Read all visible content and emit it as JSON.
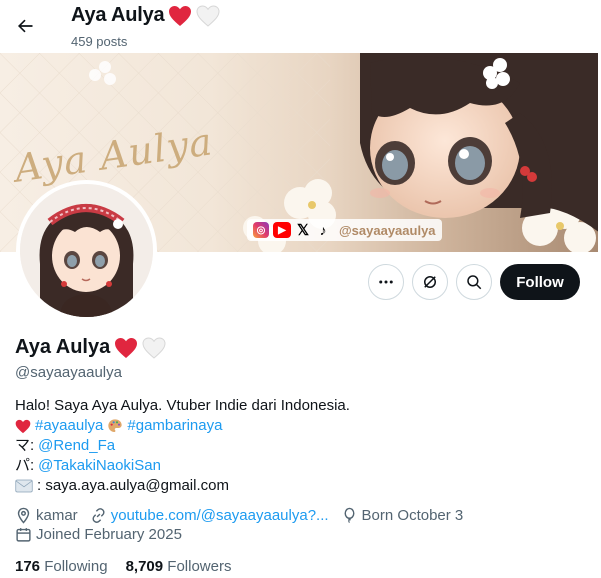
{
  "header": {
    "title": "Aya Aulya",
    "posts_count": "459 posts"
  },
  "banner": {
    "script_text": "Aya Aulya",
    "social_handle": "@sayaayaaulya",
    "social_icons": [
      "instagram-icon",
      "youtube-icon",
      "x-icon",
      "tiktok-icon"
    ]
  },
  "actions": {
    "more_icon": "more-icon",
    "grok_icon": "grok-icon",
    "search_icon": "search-icon",
    "follow_label": "Follow"
  },
  "profile": {
    "display_name": "Aya Aulya",
    "handle": "@sayaayaaulya",
    "bio": {
      "line1": "Halo! Saya Aya Aulya. Vtuber Indie dari Indonesia.",
      "hashtag1": "#ayaaulya",
      "hashtag2": "#gambarinaya",
      "mama_prefix": "マ:",
      "mama_link": "@Rend_Fa",
      "papa_prefix": "パ:",
      "papa_link": "@TakakiNaokiSan",
      "email": ": saya.aya.aulya@gmail.com"
    },
    "location": "kamar",
    "website": "youtube.com/@sayaayaaulya?...",
    "birthday": "Born October 3",
    "joined": "Joined February 2025",
    "following_count": "176",
    "following_label": "Following",
    "followers_count": "8,709",
    "followers_label": "Followers"
  },
  "colors": {
    "accent": "#1d9bf0",
    "text": "#0f1419",
    "muted": "#536471",
    "heart_red": "#e0263f"
  }
}
